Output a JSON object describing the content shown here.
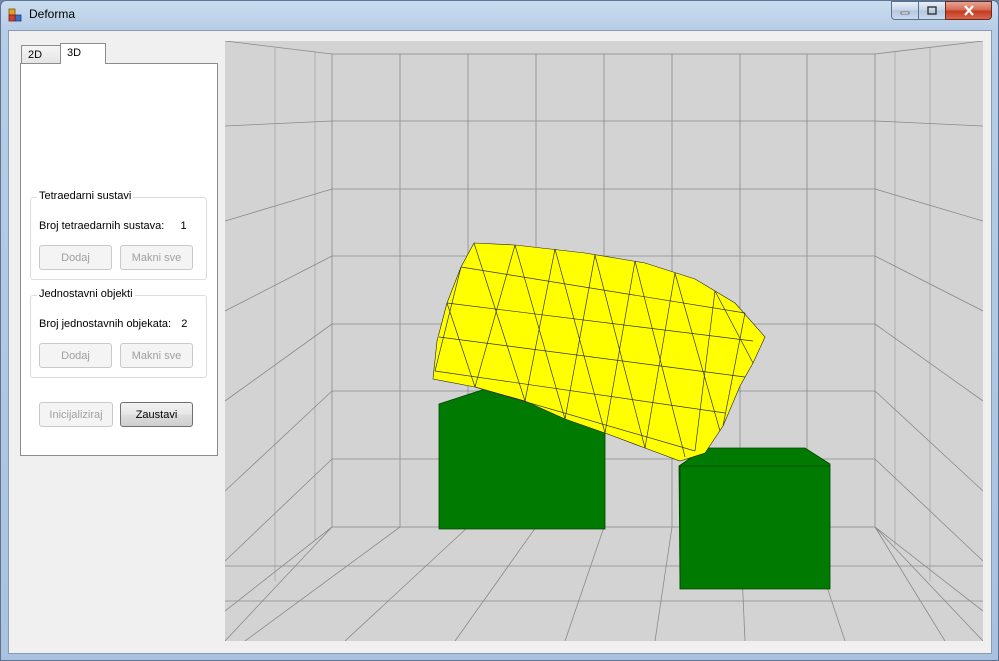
{
  "window": {
    "title": "Deforma"
  },
  "tabs": [
    {
      "label": "2D"
    },
    {
      "label": "3D"
    }
  ],
  "tetra_group": {
    "legend": "Tetraedarni sustavi",
    "count_label": "Broj tetraedarnih sustava:",
    "count_value": "1",
    "add_label": "Dodaj",
    "remove_label": "Makni sve"
  },
  "simple_group": {
    "legend": "Jednostavni objekti",
    "count_label": "Broj jednostavnih objekata:",
    "count_value": "2",
    "add_label": "Dodaj",
    "remove_label": "Makni sve"
  },
  "actions": {
    "init_label": "Inicijaliziraj",
    "stop_label": "Zaustavi"
  },
  "colors": {
    "soft_body": "#ffff00",
    "boxes": "#007a00",
    "background": "#d3d3d3",
    "grid": "#808080"
  },
  "icons": {
    "app": "app-icon",
    "minimize": "minimize-icon",
    "maximize": "maximize-icon",
    "close": "close-icon"
  }
}
